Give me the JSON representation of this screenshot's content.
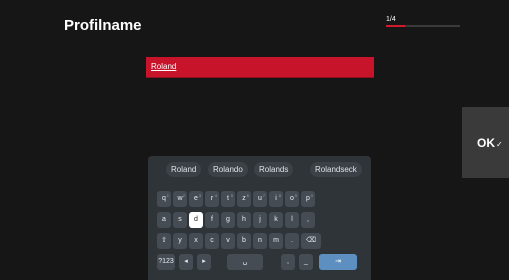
{
  "page": {
    "title": "Profilname",
    "step_label": "1/4",
    "step_progress": 0.25
  },
  "input": {
    "value": "Roland"
  },
  "ok_button": {
    "label": "OK",
    "check": "✓"
  },
  "keyboard": {
    "suggestions": [
      "Roland",
      "Rolando",
      "Rolands",
      "Rolandseck"
    ],
    "row1": [
      "q",
      "w",
      "e",
      "r",
      "t",
      "z",
      "u",
      "i",
      "o",
      "p"
    ],
    "row1_hints": [
      "1",
      "2",
      "3",
      "4",
      "5",
      "6",
      "7",
      "8",
      "9",
      "0"
    ],
    "row2": [
      "a",
      "s",
      "d",
      "f",
      "g",
      "h",
      "j",
      "k",
      "l",
      ","
    ],
    "row3": [
      "⇧",
      "y",
      "x",
      "c",
      "v",
      "b",
      "n",
      "m",
      ".",
      "⌫"
    ],
    "row4": [
      "?123",
      "◂",
      "▸",
      "␣",
      ",",
      "_",
      "⇥"
    ],
    "focused_key": "d"
  },
  "colors": {
    "accent": "#c8142a",
    "background": "#161616",
    "keyboard_bg": "#2f3439",
    "key_bg": "#454c53",
    "enter_key": "#5d8fc0"
  }
}
